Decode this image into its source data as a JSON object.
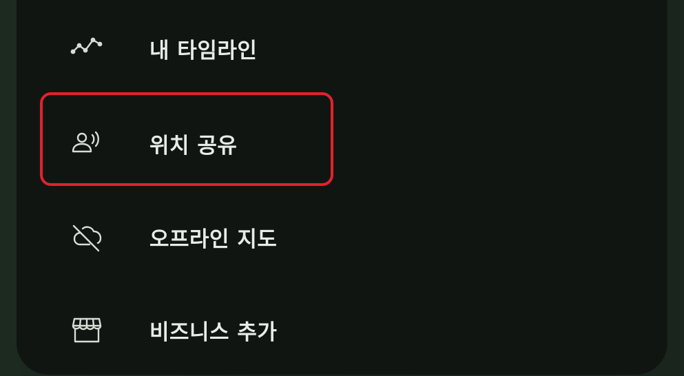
{
  "menu": {
    "items": [
      {
        "label": "내 타임라인",
        "icon": "timeline-icon"
      },
      {
        "label": "위치 공유",
        "icon": "location-sharing-icon"
      },
      {
        "label": "오프라인 지도",
        "icon": "offline-map-icon"
      },
      {
        "label": "비즈니스 추가",
        "icon": "storefront-icon"
      }
    ],
    "highlighted_index": 1
  },
  "colors": {
    "background": "#111512",
    "text": "#e8ece6",
    "icon": "#d7ddd5",
    "highlight": "#e3212d"
  }
}
